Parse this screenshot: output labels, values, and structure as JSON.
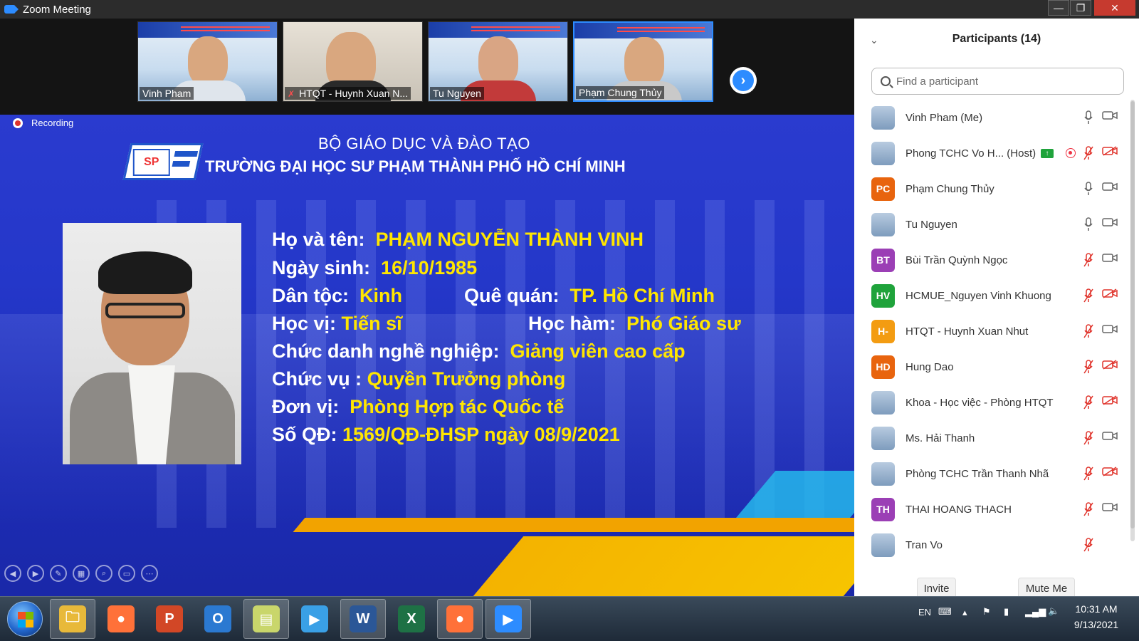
{
  "window": {
    "title": "Zoom Meeting",
    "close": "✕",
    "min": "—",
    "max": "❐"
  },
  "thumbnails": [
    {
      "name": "Vinh Pham",
      "muted": false,
      "active": false
    },
    {
      "name": "HTQT - Huynh Xuan N...",
      "muted": true,
      "active": false
    },
    {
      "name": "Tu Nguyen",
      "muted": false,
      "active": false
    },
    {
      "name": "Phạm Chung Thủy",
      "muted": false,
      "active": true
    }
  ],
  "share": {
    "recording_label": "Recording",
    "logo_text": "SP",
    "heading1": "BỘ GIÁO DỤC VÀ ĐÀO TẠO",
    "heading2": "TRƯỜNG ĐẠI HỌC SƯ PHẠM THÀNH PHỐ HỒ CHÍ MINH",
    "fields": {
      "name_label": "Họ và tên:",
      "name_value": "PHẠM NGUYỄN THÀNH VINH",
      "dob_label": "Ngày sinh:",
      "dob_value": "16/10/1985",
      "ethnic_label": "Dân tộc:",
      "ethnic_value": "Kinh",
      "hometown_label": "Quê quán:",
      "hometown_value": "TP. Hồ Chí Minh",
      "degree_label": "Học vị:",
      "degree_value": "Tiến sĩ",
      "rank_label": "Học hàm:",
      "rank_value": "Phó Giáo sư",
      "title_label": "Chức danh nghề nghiệp:",
      "title_value": "Giảng viên cao cấp",
      "position_label": "Chức vụ :",
      "position_value": "Quyền Trưởng phòng",
      "unit_label": "Đơn vị:",
      "unit_value": "Phòng Hợp tác Quốc tế",
      "decision_label": "Số QĐ:",
      "decision_value": "1569/QĐ-ĐHSP ngày 08/9/2021"
    }
  },
  "participants": {
    "title": "Participants (14)",
    "search_placeholder": "Find a participant",
    "items": [
      {
        "name": "Vinh Pham (Me)",
        "initials": "",
        "color": "",
        "mic": "on",
        "cam": "on",
        "host": false
      },
      {
        "name": "Phong TCHC Vo H... (Host)",
        "initials": "",
        "color": "",
        "mic": "muted",
        "cam": "off",
        "host": true
      },
      {
        "name": "Phạm Chung Thủy",
        "initials": "PC",
        "color": "#e8640e",
        "mic": "on",
        "cam": "on",
        "host": false
      },
      {
        "name": "Tu Nguyen",
        "initials": "",
        "color": "",
        "mic": "on",
        "cam": "on",
        "host": false
      },
      {
        "name": "Bùi Trần Quỳnh Ngọc",
        "initials": "BT",
        "color": "#9b3fb5",
        "mic": "muted",
        "cam": "on",
        "host": false
      },
      {
        "name": "HCMUE_Nguyen Vinh Khuong",
        "initials": "HV",
        "color": "#1fa33b",
        "mic": "muted",
        "cam": "off",
        "host": false
      },
      {
        "name": "HTQT - Huynh Xuan Nhut",
        "initials": "H-",
        "color": "#f39c12",
        "mic": "muted",
        "cam": "on",
        "host": false
      },
      {
        "name": "Hung Dao",
        "initials": "HD",
        "color": "#e8640e",
        "mic": "muted",
        "cam": "off",
        "host": false
      },
      {
        "name": "Khoa - Học việc - Phòng HTQT",
        "initials": "",
        "color": "",
        "mic": "muted",
        "cam": "off",
        "host": false
      },
      {
        "name": "Ms. Hải Thanh",
        "initials": "",
        "color": "",
        "mic": "muted",
        "cam": "on",
        "host": false
      },
      {
        "name": "Phòng TCHC Trần Thanh Nhã",
        "initials": "",
        "color": "",
        "mic": "muted",
        "cam": "off",
        "host": false
      },
      {
        "name": "THAI HOANG THACH",
        "initials": "TH",
        "color": "#9b3fb5",
        "mic": "muted",
        "cam": "on",
        "host": false
      },
      {
        "name": "Tran Vo",
        "initials": "",
        "color": "",
        "mic": "muted",
        "cam": "none",
        "host": false
      }
    ],
    "invite_label": "Invite",
    "mute_me_label": "Mute Me"
  },
  "taskbar": {
    "apps": [
      {
        "name": "file-explorer",
        "glyph": "🗀",
        "color": "#e8b93a",
        "active": true
      },
      {
        "name": "firefox",
        "glyph": "●",
        "color": "#ff7139",
        "active": false
      },
      {
        "name": "powerpoint",
        "glyph": "P",
        "color": "#d24726",
        "active": false
      },
      {
        "name": "outlook",
        "glyph": "O",
        "color": "#2b79d1",
        "active": false
      },
      {
        "name": "sticky-notes",
        "glyph": "▤",
        "color": "#c9d66b",
        "active": true
      },
      {
        "name": "media-player",
        "glyph": "▶",
        "color": "#3aa0e6",
        "active": false
      },
      {
        "name": "word",
        "glyph": "W",
        "color": "#2b5797",
        "active": true
      },
      {
        "name": "excel",
        "glyph": "X",
        "color": "#1e7145",
        "active": false
      },
      {
        "name": "firefox-2",
        "glyph": "●",
        "color": "#ff7139",
        "active": true
      },
      {
        "name": "zoom",
        "glyph": "▶",
        "color": "#2d8cff",
        "active": true
      }
    ],
    "lang": "EN",
    "time": "10:31 AM",
    "date": "9/13/2021"
  }
}
